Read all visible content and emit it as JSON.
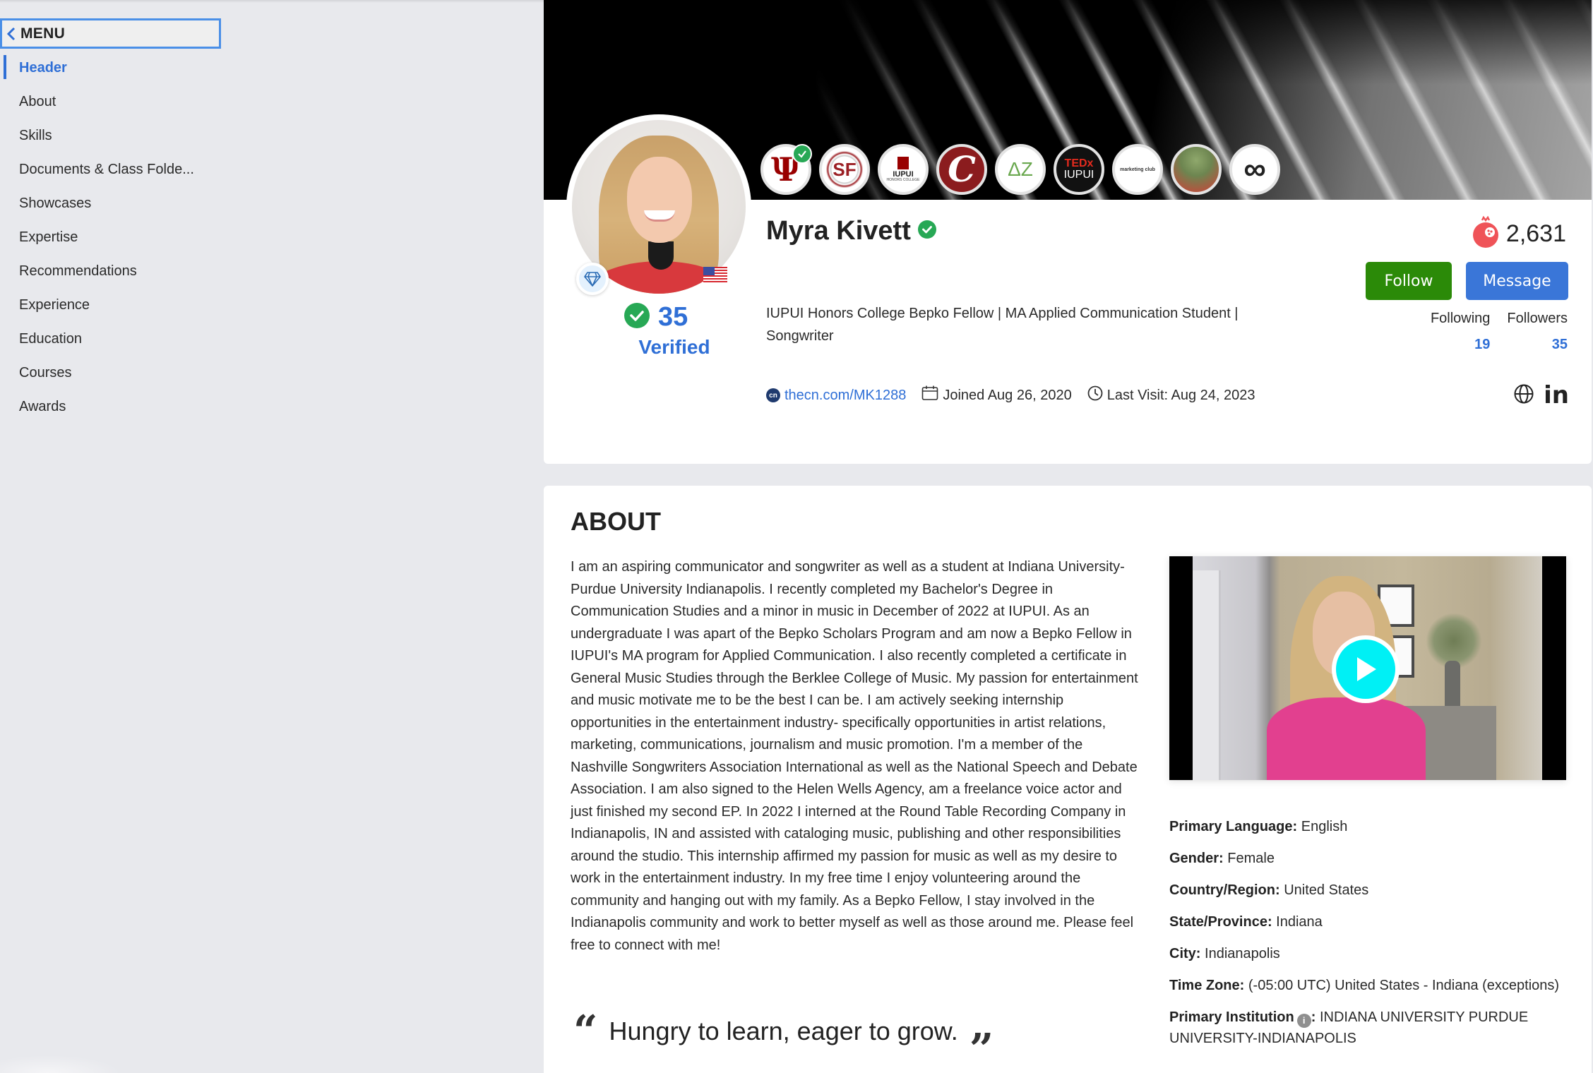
{
  "sidebar": {
    "menu_label": "MENU",
    "items": [
      {
        "label": "Header",
        "active": true
      },
      {
        "label": "About"
      },
      {
        "label": "Skills"
      },
      {
        "label": "Documents & Class Folde..."
      },
      {
        "label": "Showcases"
      },
      {
        "label": "Expertise"
      },
      {
        "label": "Recommendations"
      },
      {
        "label": "Experience"
      },
      {
        "label": "Education"
      },
      {
        "label": "Courses"
      },
      {
        "label": "Awards"
      }
    ]
  },
  "profile": {
    "name": "Myra Kivett",
    "verified_count": "35",
    "verified_label": "Verified",
    "headline": "IUPUI Honors College Bepko Fellow | MA Applied Communication Student | Songwriter",
    "profile_link": "thecn.com/MK1288",
    "joined": "Joined Aug 26, 2020",
    "last_visit": "Last Visit: Aug 24, 2023",
    "points": "2,631",
    "follow_label": "Follow",
    "message_label": "Message",
    "following_label": "Following",
    "following_count": "19",
    "followers_label": "Followers",
    "followers_count": "35",
    "country_flag": "US",
    "badges": [
      {
        "name": "Indiana University",
        "short": "Ψ",
        "verified": true
      },
      {
        "name": "CSF",
        "short": "SF"
      },
      {
        "name": "IUPUI Honors College",
        "short": "IUPUI",
        "sub": "HONORS COLLEGE"
      },
      {
        "name": "C",
        "short": "C"
      },
      {
        "name": "Delta Zeta",
        "short": "ΔZ"
      },
      {
        "name": "TEDx IUPUI",
        "short": "TEDx",
        "sub": "IUPUI"
      },
      {
        "name": "Marketing Club",
        "short": "marketing club"
      },
      {
        "name": "Mascots",
        "short": ""
      },
      {
        "name": "Global",
        "short": "∞"
      }
    ]
  },
  "about": {
    "title": "ABOUT",
    "text": "I am an aspiring communicator and songwriter as well as a student at Indiana University-Purdue University Indianapolis. I recently completed my Bachelor's Degree in Communication Studies and a minor in music in December of 2022 at IUPUI. As an undergraduate I was apart of the Bepko Scholars Program and am now a Bepko Fellow in IUPUI's MA program for Applied Communication. I also recently completed a certificate in General Music Studies through the Berklee College of Music. My passion for entertainment and music motivate me to be the best I can be. I am actively seeking internship opportunities in the entertainment industry- specifically opportunities in artist relations, marketing, communications, journalism and music promotion. I'm a member of the Nashville Songwriters Association International as well as the National Speech and Debate Association. I am also signed to the Helen Wells Agency, am a freelance voice actor and just finished my second EP. In 2022 I interned at the Round Table Recording Company in Indianapolis, IN and assisted with cataloging music, publishing and other responsibilities around the studio. This internship affirmed my passion for music as well as my desire to work in the entertainment industry. In my free time I enjoy volunteering around the community and hanging out with my family. As a Bepko Fellow, I stay involved in the Indianapolis community and work to better myself as well as those around me. Please feel free to connect with me!",
    "quote": "Hungry to learn, eager to grow.",
    "quote_open": "“",
    "quote_close": "”",
    "details": [
      {
        "key": "Primary Language:",
        "value": "English"
      },
      {
        "key": "Gender:",
        "value": "Female"
      },
      {
        "key": "Country/Region:",
        "value": "United States"
      },
      {
        "key": "State/Province:",
        "value": "Indiana"
      },
      {
        "key": "City:",
        "value": "Indianapolis"
      },
      {
        "key": "Time Zone:",
        "value": "(-05:00 UTC) United States - Indiana (exceptions)"
      },
      {
        "key": "Primary Institution",
        "value": "INDIANA UNIVERSITY PURDUE UNIVERSITY-INDIANAPOLIS",
        "info": true
      }
    ]
  },
  "colors": {
    "accent": "#2f6fd6",
    "follow": "#2b8a08",
    "message": "#3a76d8",
    "verified_green": "#27a855",
    "points_icon": "#ef5358",
    "play_button": "#00f0f5",
    "background": "#e8e9ed"
  }
}
